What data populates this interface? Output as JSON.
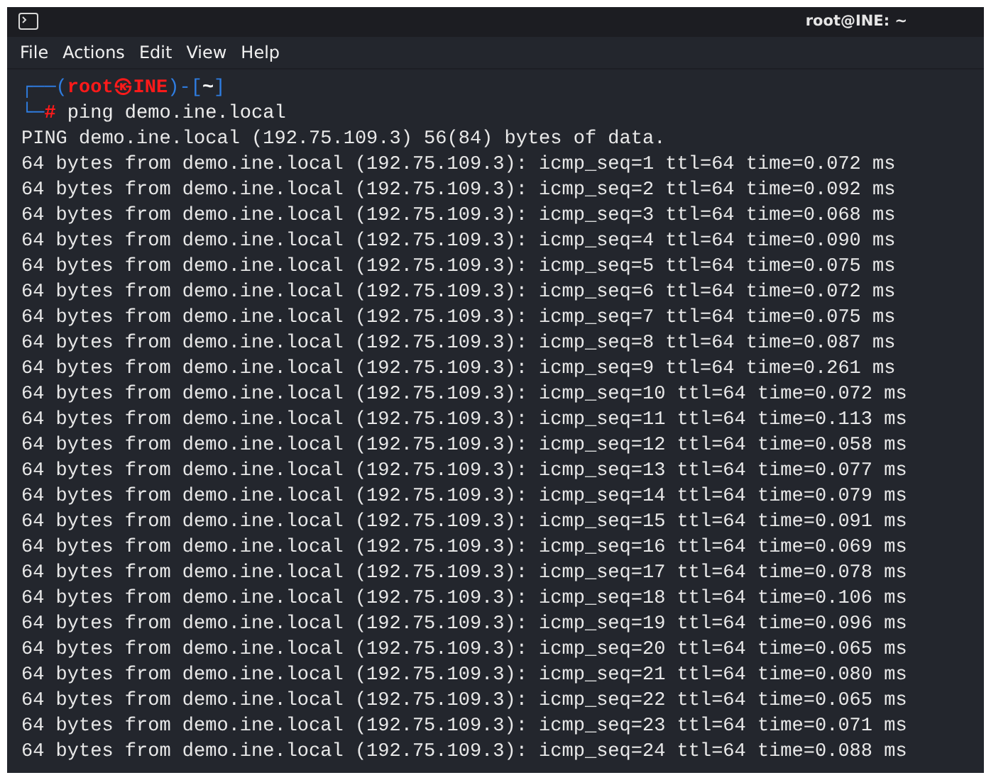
{
  "window": {
    "title": "root@INE: ~"
  },
  "menu": [
    "File",
    "Actions",
    "Edit",
    "View",
    "Help"
  ],
  "prompt": [
    [
      {
        "kind": "frame",
        "text": "┌──("
      },
      {
        "kind": "user",
        "text": "root㉿INE"
      },
      {
        "kind": "frame",
        "text": ")-["
      },
      {
        "kind": "path",
        "text": "~"
      },
      {
        "kind": "frame",
        "text": "]"
      }
    ],
    [
      {
        "kind": "frame",
        "text": "└─"
      },
      {
        "kind": "marker",
        "text": "#"
      },
      {
        "kind": "command",
        "text": " ping demo.ine.local"
      }
    ]
  ],
  "output": [
    "PING demo.ine.local (192.75.109.3) 56(84) bytes of data.",
    "64 bytes from demo.ine.local (192.75.109.3): icmp_seq=1 ttl=64 time=0.072 ms",
    "64 bytes from demo.ine.local (192.75.109.3): icmp_seq=2 ttl=64 time=0.092 ms",
    "64 bytes from demo.ine.local (192.75.109.3): icmp_seq=3 ttl=64 time=0.068 ms",
    "64 bytes from demo.ine.local (192.75.109.3): icmp_seq=4 ttl=64 time=0.090 ms",
    "64 bytes from demo.ine.local (192.75.109.3): icmp_seq=5 ttl=64 time=0.075 ms",
    "64 bytes from demo.ine.local (192.75.109.3): icmp_seq=6 ttl=64 time=0.072 ms",
    "64 bytes from demo.ine.local (192.75.109.3): icmp_seq=7 ttl=64 time=0.075 ms",
    "64 bytes from demo.ine.local (192.75.109.3): icmp_seq=8 ttl=64 time=0.087 ms",
    "64 bytes from demo.ine.local (192.75.109.3): icmp_seq=9 ttl=64 time=0.261 ms",
    "64 bytes from demo.ine.local (192.75.109.3): icmp_seq=10 ttl=64 time=0.072 ms",
    "64 bytes from demo.ine.local (192.75.109.3): icmp_seq=11 ttl=64 time=0.113 ms",
    "64 bytes from demo.ine.local (192.75.109.3): icmp_seq=12 ttl=64 time=0.058 ms",
    "64 bytes from demo.ine.local (192.75.109.3): icmp_seq=13 ttl=64 time=0.077 ms",
    "64 bytes from demo.ine.local (192.75.109.3): icmp_seq=14 ttl=64 time=0.079 ms",
    "64 bytes from demo.ine.local (192.75.109.3): icmp_seq=15 ttl=64 time=0.091 ms",
    "64 bytes from demo.ine.local (192.75.109.3): icmp_seq=16 ttl=64 time=0.069 ms",
    "64 bytes from demo.ine.local (192.75.109.3): icmp_seq=17 ttl=64 time=0.078 ms",
    "64 bytes from demo.ine.local (192.75.109.3): icmp_seq=18 ttl=64 time=0.106 ms",
    "64 bytes from demo.ine.local (192.75.109.3): icmp_seq=19 ttl=64 time=0.096 ms",
    "64 bytes from demo.ine.local (192.75.109.3): icmp_seq=20 ttl=64 time=0.065 ms",
    "64 bytes from demo.ine.local (192.75.109.3): icmp_seq=21 ttl=64 time=0.080 ms",
    "64 bytes from demo.ine.local (192.75.109.3): icmp_seq=22 ttl=64 time=0.065 ms",
    "64 bytes from demo.ine.local (192.75.109.3): icmp_seq=23 ttl=64 time=0.071 ms",
    "64 bytes from demo.ine.local (192.75.109.3): icmp_seq=24 ttl=64 time=0.088 ms"
  ]
}
